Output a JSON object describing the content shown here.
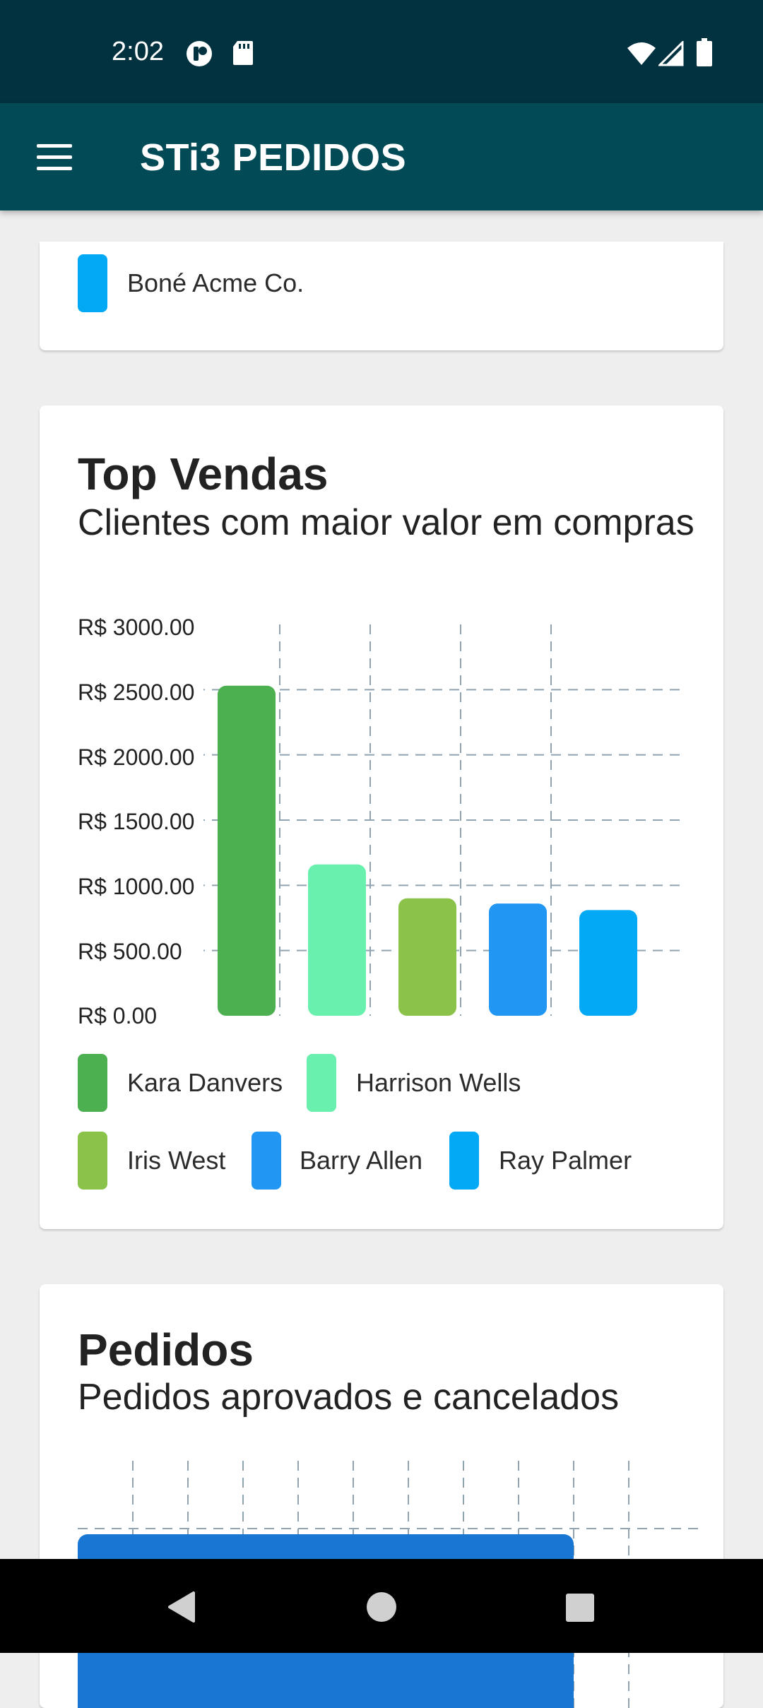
{
  "status_bar": {
    "time": "2:02",
    "icons": [
      "notification-app-icon",
      "sd-card-icon",
      "wifi-icon",
      "signal-icon",
      "battery-icon"
    ]
  },
  "app_bar": {
    "title": "STi3 PEDIDOS",
    "menu_icon": "hamburger-menu-icon",
    "background": "#034a57"
  },
  "partial_card": {
    "legend": [
      {
        "label": "Boné Acme Co.",
        "color": "#03a9f4"
      }
    ]
  },
  "top_vendas": {
    "title": "Top Vendas",
    "subtitle": "Clientes com maior valor em compras",
    "chart_data": {
      "type": "bar",
      "title": "Top Vendas",
      "subtitle": "Clientes com maior valor em compras",
      "categories": [
        "Kara Danvers",
        "Harrison Wells",
        "Iris West",
        "Barry Allen",
        "Ray Palmer"
      ],
      "values": [
        2530,
        1160,
        900,
        860,
        810
      ],
      "colors": [
        "#4caf50",
        "#69f0ae",
        "#8bc34a",
        "#2196f3",
        "#03a9f4"
      ],
      "y_ticks": [
        "R$ 0.00",
        "R$ 500.00",
        "R$ 1000.00",
        "R$ 1500.00",
        "R$ 2000.00",
        "R$ 2500.00",
        "R$ 3000.00"
      ],
      "ylim": [
        0,
        3000
      ],
      "grid": true,
      "legend_position": "bottom"
    }
  },
  "pedidos": {
    "title": "Pedidos",
    "subtitle": "Pedidos aprovados e cancelados",
    "bar_color": "#1976d2"
  },
  "nav_bar": {
    "buttons": [
      "back-icon",
      "home-icon",
      "recents-icon"
    ]
  }
}
